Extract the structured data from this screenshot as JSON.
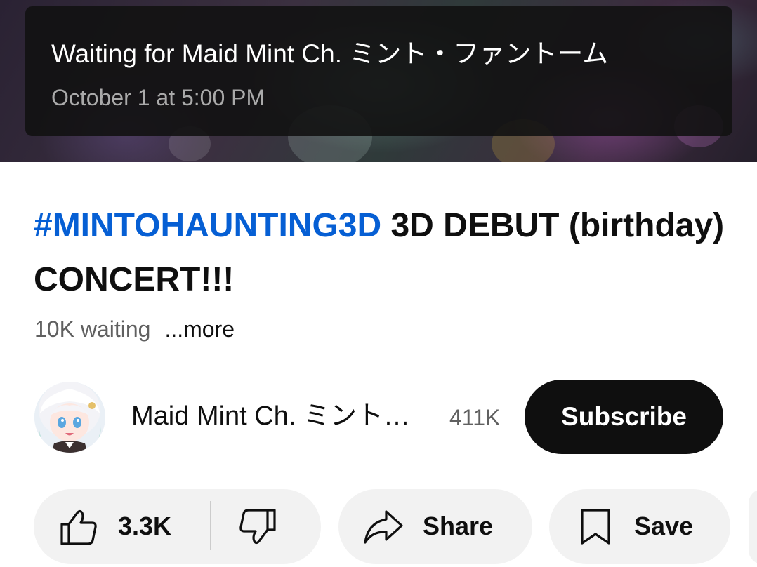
{
  "waiting_banner": {
    "title": "Waiting for Maid Mint Ch. ミント・ファントーム",
    "scheduled_time": "October 1 at 5:00 PM"
  },
  "video": {
    "hashtag": "#MINTOHAUNTING3D",
    "title_rest": " 3D DEBUT (birthday) CONCERT!!!",
    "waiting_count": "10K waiting",
    "more_label": "...more"
  },
  "channel": {
    "name": "Maid Mint Ch. ミント…",
    "subscriber_count": "411K",
    "subscribe_label": "Subscribe"
  },
  "actions": {
    "like_count": "3.3K",
    "share_label": "Share",
    "save_label": "Save"
  },
  "icons": {
    "like": "thumbs-up-icon",
    "dislike": "thumbs-down-icon",
    "share": "share-arrow-icon",
    "save": "bookmark-icon"
  },
  "colors": {
    "hashtag": "#065fd4",
    "subscribe_bg": "#0f0f0f",
    "pill_bg": "#f2f2f2",
    "secondary_text": "#606060"
  }
}
